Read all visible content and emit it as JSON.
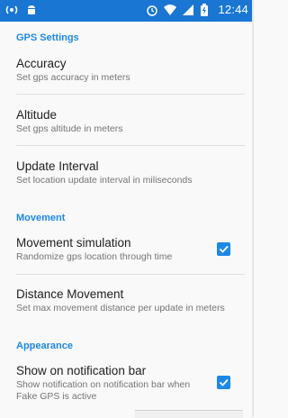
{
  "status_bar": {
    "time": "12:44",
    "left_icons": [
      "broadcast-icon",
      "android-icon"
    ],
    "right_icons": [
      "alarm-icon",
      "wifi-icon",
      "signal-icon",
      "battery-icon"
    ]
  },
  "sections": [
    {
      "header": "GPS Settings",
      "items": [
        {
          "title": "Accuracy",
          "summary": "Set gps accuracy in meters"
        },
        {
          "title": "Altitude",
          "summary": "Set gps altitude in meters"
        },
        {
          "title": "Update Interval",
          "summary": "Set location update interval in miliseconds"
        }
      ]
    },
    {
      "header": "Movement",
      "items": [
        {
          "title": "Movement simulation",
          "summary": "Randomize gps location through time",
          "checked": true
        },
        {
          "title": "Distance Movement",
          "summary": "Set max movement distance per update in meters"
        }
      ]
    },
    {
      "header": "Appearance",
      "items": [
        {
          "title": "Show on notification bar",
          "summary": "Show notification on notification bar when Fake GPS is active",
          "checked": true
        }
      ]
    }
  ],
  "colors": {
    "status_bar": "#1976d2",
    "accent": "#1e88e5"
  }
}
